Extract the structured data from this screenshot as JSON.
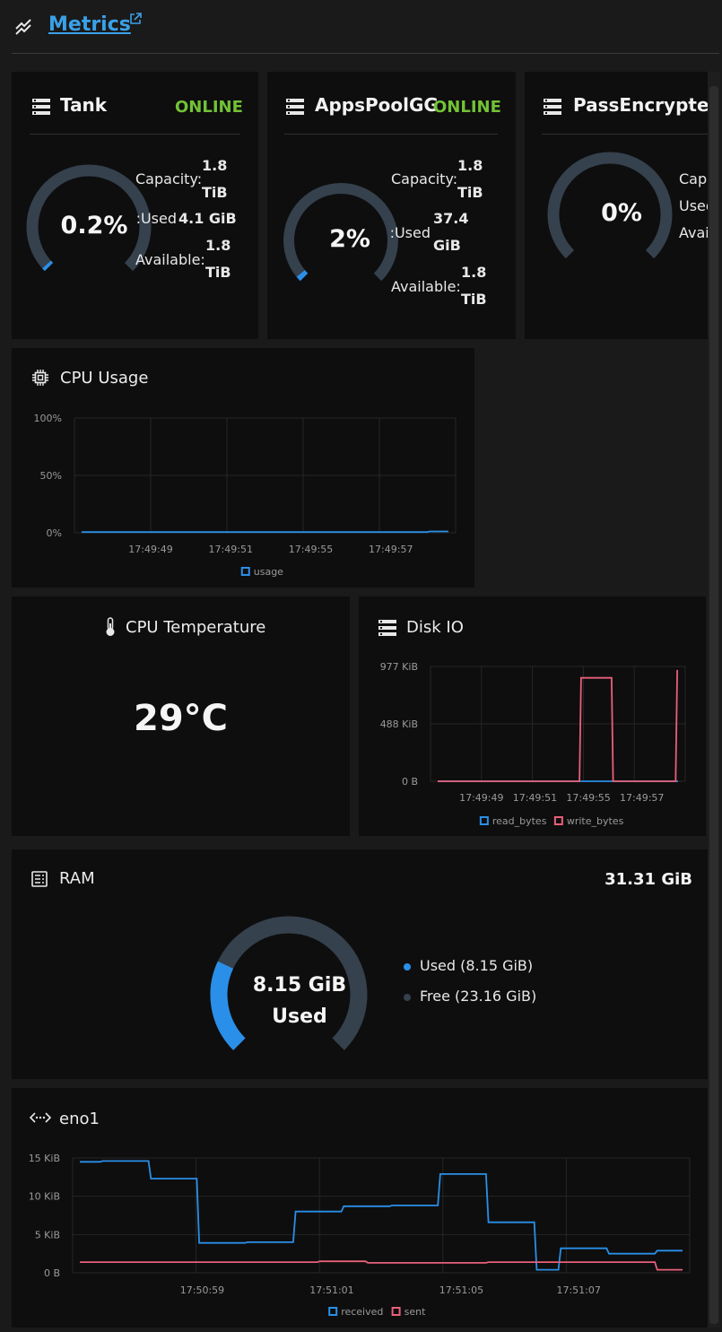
{
  "header": {
    "title": "Metrics",
    "icon": "chart-line-icon",
    "link_icon": "external-link-icon"
  },
  "pools": [
    {
      "name": "Tank",
      "status": "ONLINE",
      "percent": "0.2%",
      "fraction": 0.002,
      "capacity_label": "Capacity:",
      "capacity": "1.8 TiB",
      "used_label": "Used:",
      "used": "4.1 GiB",
      "available_label": "Available:",
      "available": "1.8 TiB"
    },
    {
      "name": "AppsPoolGG",
      "status": "ONLINE",
      "percent": "2%",
      "fraction": 0.02,
      "capacity_label": "Capacity:",
      "capacity": "1.8 TiB",
      "used_label": "Used:",
      "used": "37.4 GiB",
      "available_label": "Available:",
      "available": "1.8 TiB"
    },
    {
      "name": "PassEncrypted",
      "status": "",
      "percent": "0%",
      "fraction": 0.0,
      "capacity_label": "Capacity:",
      "used_label": "Used:",
      "available_label": "Available:"
    }
  ],
  "cpu_usage": {
    "title": "CPU Usage",
    "icon": "cpu-icon"
  },
  "cpu_temp": {
    "title": "CPU Temperature",
    "value": "29°C",
    "icon": "thermometer-icon"
  },
  "disk_io": {
    "title": "Disk IO",
    "icon": "storage-icon"
  },
  "ram": {
    "title": "RAM",
    "total": "31.31 GiB",
    "center_value": "8.15 GiB",
    "center_label": "Used",
    "used_fraction": 0.26,
    "legend": [
      {
        "label": "Used (8.15 GiB)",
        "color": "#2a8fe8"
      },
      {
        "label": "Free (23.16 GiB)",
        "color": "#35414d"
      }
    ],
    "icon": "memory-icon"
  },
  "net": {
    "title": "eno1",
    "icon": "network-icon"
  },
  "colors": {
    "accent": "#2a8fe8",
    "online": "#72c236",
    "write": "#e8607a",
    "gauge_track": "#35414d"
  },
  "chart_data": [
    {
      "type": "line",
      "title": "CPU Usage",
      "yticks": [
        "100%",
        "50%",
        "0%"
      ],
      "ylim": [
        0,
        100
      ],
      "xticks": [
        "17:49:49",
        "17:49:51",
        "17:49:55",
        "17:49:57"
      ],
      "series": [
        {
          "name": "usage",
          "color": "#2a8fe8",
          "values": [
            0.6,
            0.6,
            0.6,
            0.6,
            0.6,
            0.6,
            0.6,
            0.6,
            0.6,
            0.6,
            0.6,
            0.6,
            0.6,
            0.6,
            0.6,
            0.6,
            0.6,
            0.6,
            0.6,
            1.2,
            1.2
          ]
        }
      ]
    },
    {
      "type": "line",
      "title": "Disk IO",
      "yticks": [
        "977 KiB",
        "488 KiB",
        "0 B"
      ],
      "ylim": [
        0,
        977
      ],
      "xticks": [
        "17:49:49",
        "17:49:51",
        "17:49:55",
        "17:49:57"
      ],
      "series": [
        {
          "name": "read_bytes",
          "color": "#2a8fe8",
          "values": [
            0,
            0,
            0,
            0,
            0,
            0,
            0,
            0,
            0,
            0,
            0,
            0,
            0,
            0,
            0,
            0
          ]
        },
        {
          "name": "write_bytes",
          "color": "#e8607a",
          "values": [
            0,
            0,
            0,
            0,
            0,
            0,
            0,
            0,
            0,
            880,
            880,
            0,
            0,
            0,
            0,
            940
          ]
        }
      ]
    },
    {
      "type": "line",
      "title": "eno1",
      "yticks": [
        "15 KiB",
        "10 KiB",
        "5 KiB",
        "0 B"
      ],
      "ylim": [
        0,
        15
      ],
      "xticks": [
        "17:50:59",
        "17:51:01",
        "17:51:05",
        "17:51:07"
      ],
      "series": [
        {
          "name": "received",
          "color": "#2a8fe8",
          "values": [
            14.5,
            14.6,
            14.6,
            12.3,
            12.3,
            3.9,
            3.9,
            4.0,
            4.0,
            8.0,
            8.0,
            8.7,
            8.7,
            8.8,
            8.8,
            12.9,
            12.9,
            6.6,
            6.6,
            0.4,
            3.2,
            3.2,
            2.5,
            2.5,
            2.9,
            2.9
          ]
        },
        {
          "name": "sent",
          "color": "#e8607a",
          "values": [
            1.4,
            1.4,
            1.4,
            1.4,
            1.4,
            1.4,
            1.4,
            1.4,
            1.4,
            1.4,
            1.5,
            1.5,
            1.3,
            1.3,
            1.3,
            1.3,
            1.3,
            1.4,
            1.4,
            1.4,
            1.4,
            1.4,
            1.4,
            1.4,
            0.4,
            0.4
          ]
        }
      ]
    }
  ]
}
